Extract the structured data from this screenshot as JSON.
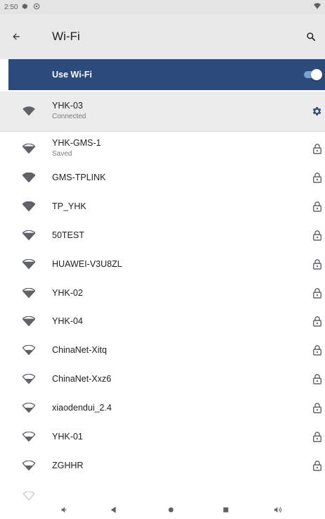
{
  "status_bar": {
    "time": "2:50",
    "icons": [
      "gear-icon",
      "sync-icon",
      "wifi-signal-icon"
    ]
  },
  "app_bar": {
    "title": "Wi-Fi",
    "back_icon": "arrow-back-icon",
    "search_icon": "search-icon"
  },
  "master_switch": {
    "label": "Use Wi-Fi",
    "on": true
  },
  "connected_network": {
    "name": "YHK-03",
    "status": "Connected",
    "action_icon": "gear-icon"
  },
  "networks": [
    {
      "name": "YHK-GMS-1",
      "status": "Saved",
      "strength": 3
    },
    {
      "name": "GMS-TPLINK",
      "status": "",
      "strength": 4
    },
    {
      "name": "TP_YHK",
      "status": "",
      "strength": 4
    },
    {
      "name": "50TEST",
      "status": "",
      "strength": 3
    },
    {
      "name": "HUAWEI-V3U8ZL",
      "status": "",
      "strength": 3
    },
    {
      "name": "YHK-02",
      "status": "",
      "strength": 3
    },
    {
      "name": "YHK-04",
      "status": "",
      "strength": 3
    },
    {
      "name": "ChinaNet-Xitq",
      "status": "",
      "strength": 2
    },
    {
      "name": "ChinaNet-Xxz6",
      "status": "",
      "strength": 2
    },
    {
      "name": "xiaodendui_2.4",
      "status": "",
      "strength": 2
    },
    {
      "name": "YHK-01",
      "status": "",
      "strength": 2
    },
    {
      "name": "ZGHHR",
      "status": "",
      "strength": 2
    }
  ],
  "colors": {
    "accent": "#2c4a7c",
    "app_bar": "#e9e9e9",
    "status_bar": "#e4e4e4",
    "icon": "#5f6368",
    "gear_accent": "#2c4a7c"
  },
  "nav_bar": {
    "buttons": [
      "volume-down-icon",
      "back-triangle-icon",
      "home-circle-icon",
      "recents-square-icon",
      "volume-up-icon"
    ]
  }
}
